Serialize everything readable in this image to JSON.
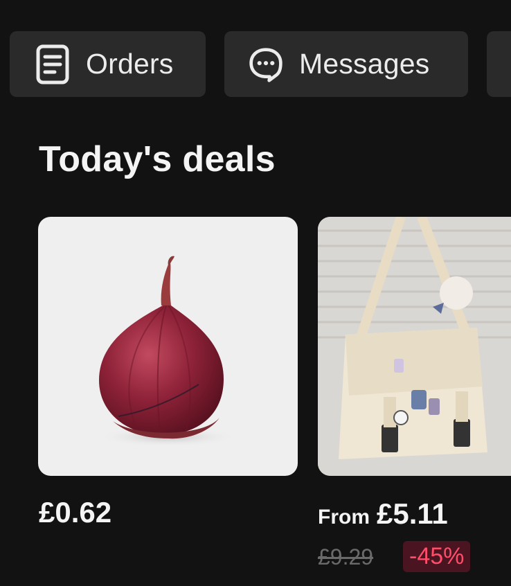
{
  "quick_actions": {
    "orders_label": "Orders",
    "messages_label": "Messages"
  },
  "deals": {
    "title": "Today's deals",
    "items": [
      {
        "image": "red-onion",
        "price": "£0.62"
      },
      {
        "image": "cream-messenger-bag",
        "price_prefix": "From",
        "price": "£5.11",
        "old_price": "£9.29",
        "discount": "-45%"
      }
    ]
  },
  "colors": {
    "background": "#121212",
    "button_bg": "#2a2a2a",
    "discount_bg": "#4a1420",
    "discount_text": "#ff4d6a"
  }
}
